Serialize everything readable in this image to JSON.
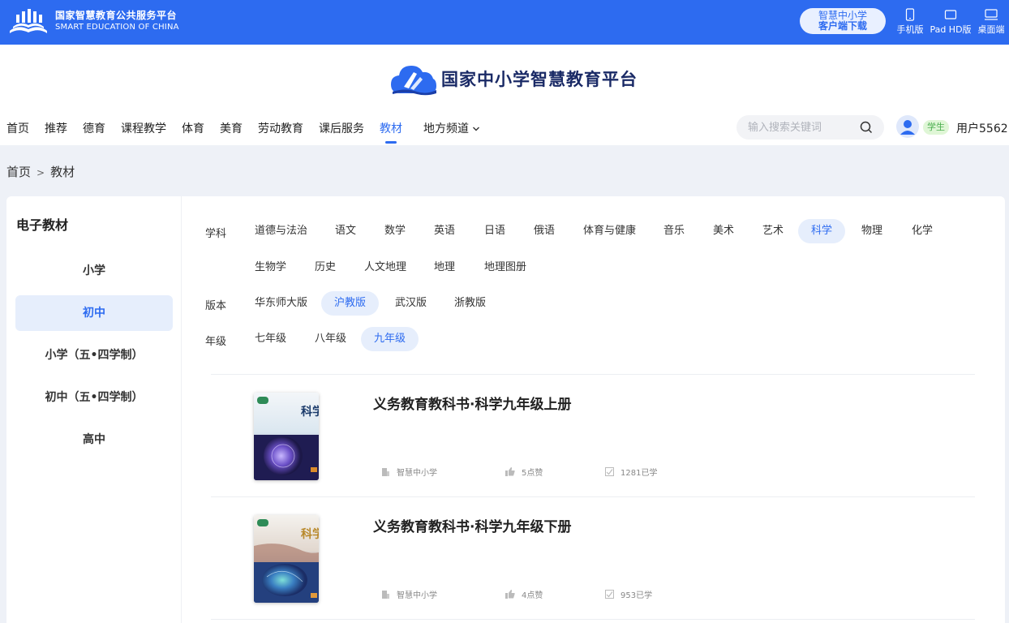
{
  "topbar": {
    "brand_cn": "国家智慧教育公共服务平台",
    "brand_en": "SMART EDUCATION OF CHINA",
    "download_line1": "智慧中小学",
    "download_line2": "客户端下载",
    "devices": [
      "手机版",
      "Pad HD版",
      "桌面端"
    ]
  },
  "header": {
    "site_title": "国家中小学智慧教育平台",
    "nav": [
      "首页",
      "推荐",
      "德育",
      "课程教学",
      "体育",
      "美育",
      "劳动教育",
      "课后服务",
      "教材",
      "地方频道"
    ],
    "nav_active": "教材",
    "search_placeholder": "输入搜索关键词",
    "role": "学生",
    "username": "用户5562"
  },
  "breadcrumb": {
    "home": "首页",
    "sep": ">",
    "current": "教材"
  },
  "sidebar": {
    "title": "电子教材",
    "items": [
      "小学",
      "初中",
      "小学（五•四学制）",
      "初中（五•四学制）",
      "高中"
    ],
    "active": "初中"
  },
  "filters": {
    "subject_label": "学科",
    "subjects_row1": [
      "道德与法治",
      "语文",
      "数学",
      "英语",
      "日语",
      "俄语",
      "体育与健康",
      "音乐",
      "美术",
      "艺术",
      "科学",
      "物理",
      "化学"
    ],
    "subjects_row2": [
      "生物学",
      "历史",
      "人文地理",
      "地理",
      "地理图册"
    ],
    "subject_active": "科学",
    "edition_label": "版本",
    "editions": [
      "华东师大版",
      "沪教版",
      "武汉版",
      "浙教版"
    ],
    "edition_active": "沪教版",
    "grade_label": "年级",
    "grades": [
      "七年级",
      "八年级",
      "九年级"
    ],
    "grade_active": "九年级"
  },
  "books": [
    {
      "title": "义务教育教科书·科学九年级上册",
      "publisher": "智慧中小学",
      "likes": "5点赞",
      "learners": "1281已学",
      "cover_text": "科学"
    },
    {
      "title": "义务教育教科书·科学九年级下册",
      "publisher": "智慧中小学",
      "likes": "4点赞",
      "learners": "953已学",
      "cover_text": "科学"
    }
  ],
  "colors": {
    "primary": "#2d6bf0",
    "active_bg": "#e6eefc",
    "badge_bg": "#dff6d6",
    "badge_text": "#4caf50"
  }
}
